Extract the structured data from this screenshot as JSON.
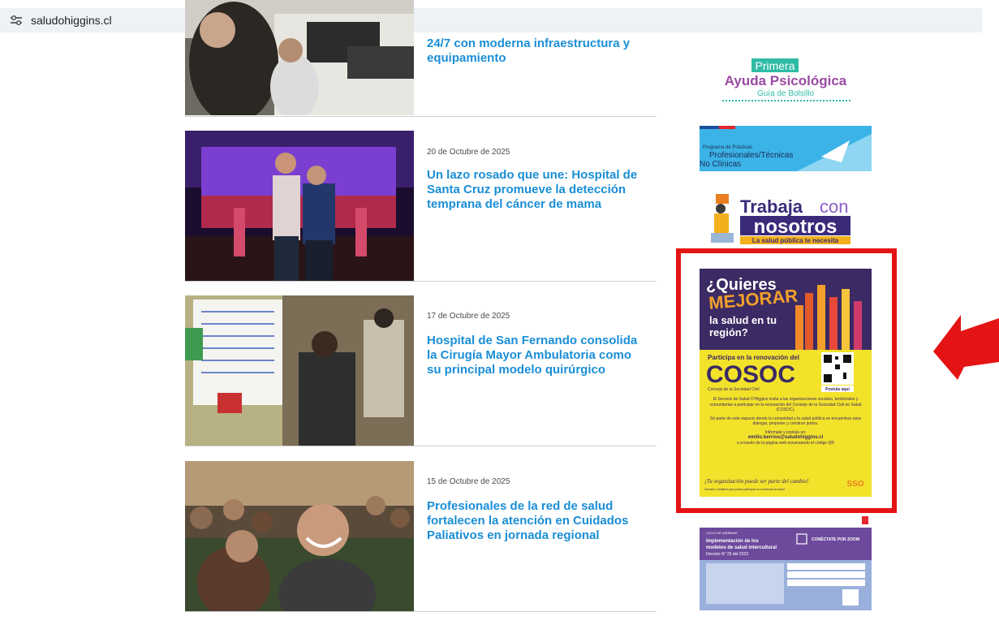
{
  "browser": {
    "url": "saludohiggins.cl"
  },
  "news": [
    {
      "date": "",
      "headline": "24/7 con moderna infraestructura y equipamiento"
    },
    {
      "date": "20 de Octubre de 2025",
      "headline": "Un lazo rosado que une: Hospital de Santa Cruz promueve la detección temprana del cáncer de mama"
    },
    {
      "date": "17 de Octubre de 2025",
      "headline": "Hospital de San Fernando consolida la Cirugía Mayor Ambulatoria como su principal modelo quirúrgico"
    },
    {
      "date": "15 de Octubre de 2025",
      "headline": "Profesionales de la red de salud fortalecen la atención en Cuidados Paliativos en jornada regional"
    }
  ],
  "sidebar": {
    "psico": {
      "line1": "Primera",
      "line2": "Ayuda Psicológica",
      "line3": "Guía de Bolsillo"
    },
    "practicas": {
      "small": "Programa de Prácticas",
      "line1": "Profesionales/Técnicas",
      "line2": "No Clínicas"
    },
    "trabaja": {
      "line1": "Trabaja",
      "con": "con",
      "line2": "nosotros",
      "tagline": "La salud pública te necesita"
    },
    "cosoc": {
      "q1": "¿Quieres",
      "q2": "MEJORAR",
      "q3": "la salud en tu",
      "q4": "región?",
      "participa": "Participa en la renovación del",
      "cosoc": "COSOC",
      "consejo": "Consejo de la Sociedad Civil",
      "postula": "Postula aquí",
      "body1": "El Servicio de Salud O'Higgins invita a las organizaciones sociales, territoriales y comunitarias a participar en la renovación del Consejo de la Sociedad Civil en Salud (COSOC).",
      "body2": "Sé parte de este espacio donde la comunidad y la salud pública se encuentran para dialogar, proponer y construir juntos.",
      "body3": "Infórmate y postula en:",
      "email": "emilio.berrios@saludohiggins.cl",
      "body4": "o a través de la página web escaneando el código QR",
      "slogan": "¡Tu organización puede ser parte del cambio!",
      "footer": "Sumate y fortalece para juntos participar en el sistema de salud"
    },
    "ciclo": {
      "tag": "CICLO DE WEBINAR",
      "title1": "Implementación de los",
      "title2": "modelos de salud intercultural",
      "decreto": "Decreto N° 25 del 2023",
      "zoom": "CONÉCTATE POR ZOOM"
    }
  },
  "colors": {
    "link": "#1a8ed6",
    "highlight": "#e41414",
    "cosoc_purple": "#3b2a63",
    "cosoc_yellow": "#f3e22a"
  }
}
